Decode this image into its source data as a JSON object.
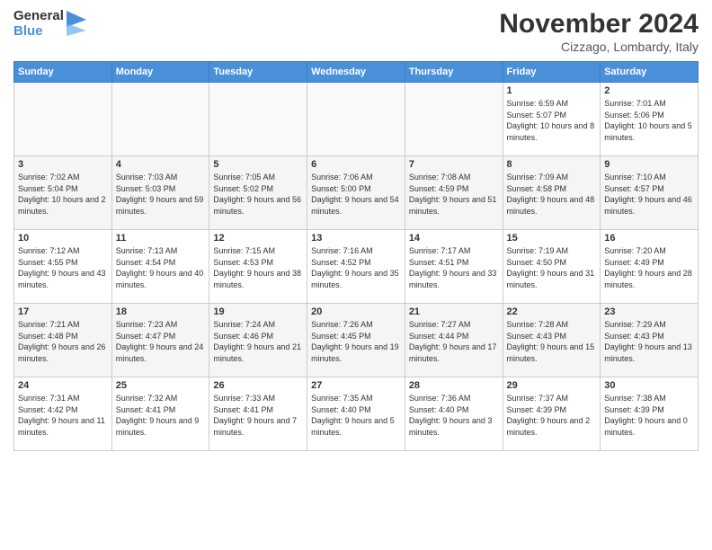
{
  "header": {
    "logo_line1": "General",
    "logo_line2": "Blue",
    "month": "November 2024",
    "location": "Cizzago, Lombardy, Italy"
  },
  "days_of_week": [
    "Sunday",
    "Monday",
    "Tuesday",
    "Wednesday",
    "Thursday",
    "Friday",
    "Saturday"
  ],
  "weeks": [
    [
      {
        "day": "",
        "info": ""
      },
      {
        "day": "",
        "info": ""
      },
      {
        "day": "",
        "info": ""
      },
      {
        "day": "",
        "info": ""
      },
      {
        "day": "",
        "info": ""
      },
      {
        "day": "1",
        "info": "Sunrise: 6:59 AM\nSunset: 5:07 PM\nDaylight: 10 hours and 8 minutes."
      },
      {
        "day": "2",
        "info": "Sunrise: 7:01 AM\nSunset: 5:06 PM\nDaylight: 10 hours and 5 minutes."
      }
    ],
    [
      {
        "day": "3",
        "info": "Sunrise: 7:02 AM\nSunset: 5:04 PM\nDaylight: 10 hours and 2 minutes."
      },
      {
        "day": "4",
        "info": "Sunrise: 7:03 AM\nSunset: 5:03 PM\nDaylight: 9 hours and 59 minutes."
      },
      {
        "day": "5",
        "info": "Sunrise: 7:05 AM\nSunset: 5:02 PM\nDaylight: 9 hours and 56 minutes."
      },
      {
        "day": "6",
        "info": "Sunrise: 7:06 AM\nSunset: 5:00 PM\nDaylight: 9 hours and 54 minutes."
      },
      {
        "day": "7",
        "info": "Sunrise: 7:08 AM\nSunset: 4:59 PM\nDaylight: 9 hours and 51 minutes."
      },
      {
        "day": "8",
        "info": "Sunrise: 7:09 AM\nSunset: 4:58 PM\nDaylight: 9 hours and 48 minutes."
      },
      {
        "day": "9",
        "info": "Sunrise: 7:10 AM\nSunset: 4:57 PM\nDaylight: 9 hours and 46 minutes."
      }
    ],
    [
      {
        "day": "10",
        "info": "Sunrise: 7:12 AM\nSunset: 4:55 PM\nDaylight: 9 hours and 43 minutes."
      },
      {
        "day": "11",
        "info": "Sunrise: 7:13 AM\nSunset: 4:54 PM\nDaylight: 9 hours and 40 minutes."
      },
      {
        "day": "12",
        "info": "Sunrise: 7:15 AM\nSunset: 4:53 PM\nDaylight: 9 hours and 38 minutes."
      },
      {
        "day": "13",
        "info": "Sunrise: 7:16 AM\nSunset: 4:52 PM\nDaylight: 9 hours and 35 minutes."
      },
      {
        "day": "14",
        "info": "Sunrise: 7:17 AM\nSunset: 4:51 PM\nDaylight: 9 hours and 33 minutes."
      },
      {
        "day": "15",
        "info": "Sunrise: 7:19 AM\nSunset: 4:50 PM\nDaylight: 9 hours and 31 minutes."
      },
      {
        "day": "16",
        "info": "Sunrise: 7:20 AM\nSunset: 4:49 PM\nDaylight: 9 hours and 28 minutes."
      }
    ],
    [
      {
        "day": "17",
        "info": "Sunrise: 7:21 AM\nSunset: 4:48 PM\nDaylight: 9 hours and 26 minutes."
      },
      {
        "day": "18",
        "info": "Sunrise: 7:23 AM\nSunset: 4:47 PM\nDaylight: 9 hours and 24 minutes."
      },
      {
        "day": "19",
        "info": "Sunrise: 7:24 AM\nSunset: 4:46 PM\nDaylight: 9 hours and 21 minutes."
      },
      {
        "day": "20",
        "info": "Sunrise: 7:26 AM\nSunset: 4:45 PM\nDaylight: 9 hours and 19 minutes."
      },
      {
        "day": "21",
        "info": "Sunrise: 7:27 AM\nSunset: 4:44 PM\nDaylight: 9 hours and 17 minutes."
      },
      {
        "day": "22",
        "info": "Sunrise: 7:28 AM\nSunset: 4:43 PM\nDaylight: 9 hours and 15 minutes."
      },
      {
        "day": "23",
        "info": "Sunrise: 7:29 AM\nSunset: 4:43 PM\nDaylight: 9 hours and 13 minutes."
      }
    ],
    [
      {
        "day": "24",
        "info": "Sunrise: 7:31 AM\nSunset: 4:42 PM\nDaylight: 9 hours and 11 minutes."
      },
      {
        "day": "25",
        "info": "Sunrise: 7:32 AM\nSunset: 4:41 PM\nDaylight: 9 hours and 9 minutes."
      },
      {
        "day": "26",
        "info": "Sunrise: 7:33 AM\nSunset: 4:41 PM\nDaylight: 9 hours and 7 minutes."
      },
      {
        "day": "27",
        "info": "Sunrise: 7:35 AM\nSunset: 4:40 PM\nDaylight: 9 hours and 5 minutes."
      },
      {
        "day": "28",
        "info": "Sunrise: 7:36 AM\nSunset: 4:40 PM\nDaylight: 9 hours and 3 minutes."
      },
      {
        "day": "29",
        "info": "Sunrise: 7:37 AM\nSunset: 4:39 PM\nDaylight: 9 hours and 2 minutes."
      },
      {
        "day": "30",
        "info": "Sunrise: 7:38 AM\nSunset: 4:39 PM\nDaylight: 9 hours and 0 minutes."
      }
    ]
  ]
}
